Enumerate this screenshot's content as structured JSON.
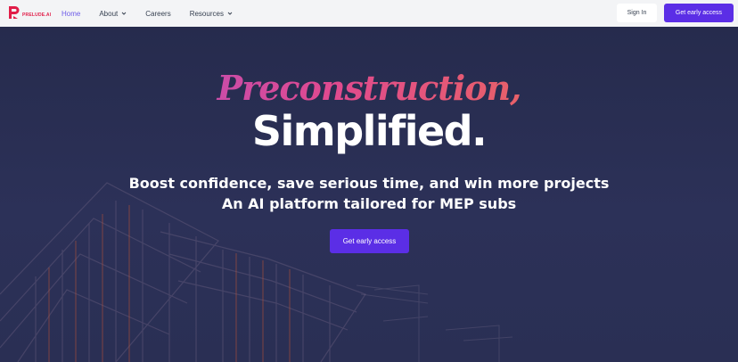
{
  "brand": {
    "name": "PRELUDE.AI",
    "accent": "#e11d48"
  },
  "nav": {
    "items": [
      {
        "label": "Home",
        "active": true,
        "has_dropdown": false
      },
      {
        "label": "About",
        "active": false,
        "has_dropdown": true
      },
      {
        "label": "Careers",
        "active": false,
        "has_dropdown": false
      },
      {
        "label": "Resources",
        "active": false,
        "has_dropdown": true
      }
    ],
    "signin_label": "Sign In",
    "cta_label": "Get early access"
  },
  "hero": {
    "headline_script": "Preconstruction,",
    "headline_main": "Simplified.",
    "subtitle_1": "Boost confidence, save serious time, and win more projects",
    "subtitle_2": "An AI platform tailored for MEP subs",
    "cta_label": "Get early access"
  },
  "colors": {
    "primary": "#5b2ee6",
    "hero_bg": "#2a2f52",
    "nav_bg": "#f3f4f6"
  }
}
